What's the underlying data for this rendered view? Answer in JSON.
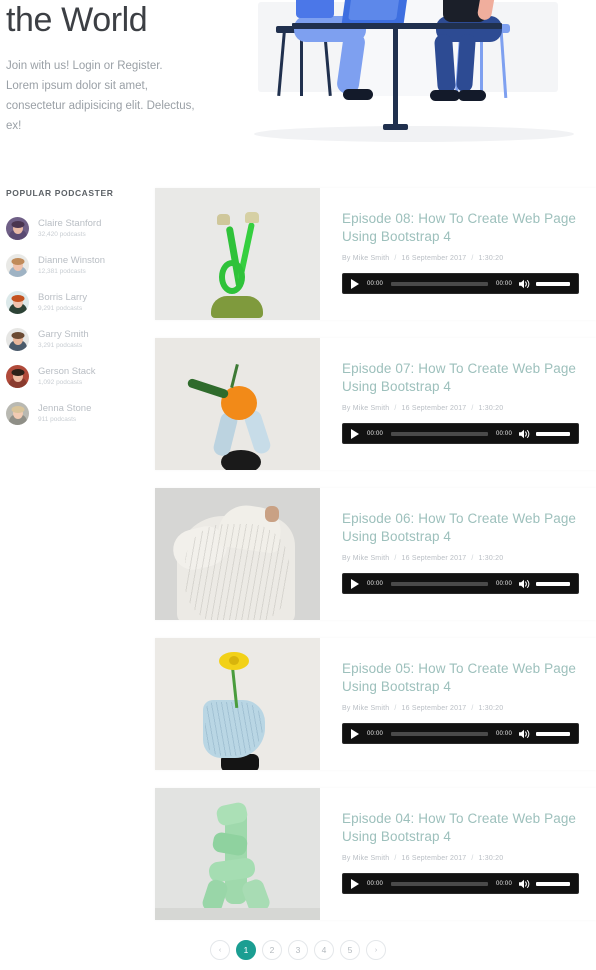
{
  "hero": {
    "title": "the World",
    "subtitle": "Join with us! Login or Register. Lorem ipsum dolor sit amet, consectetur adipisicing elit. Delectus, ex!",
    "illustration_name": "two-people-at-table-illustration"
  },
  "sidebar": {
    "title": "POPULAR PODCASTER",
    "podcasters": [
      {
        "name": "Claire Stanford",
        "count": "32,420 podcasts"
      },
      {
        "name": "Dianne Winston",
        "count": "12,381 podcasts"
      },
      {
        "name": "Borris Larry",
        "count": "9,291 podcasts"
      },
      {
        "name": "Garry Smith",
        "count": "3,291 podcasts"
      },
      {
        "name": "Gerson Stack",
        "count": "1,092 podcasts"
      },
      {
        "name": "Jenna Stone",
        "count": "911 podcasts"
      }
    ]
  },
  "episodes": [
    {
      "title": "Episode 08: How To Create Web Page Using Bootstrap 4",
      "author": "By Mike Smith",
      "date": "16 September 2017",
      "duration": "1:30:20",
      "thumb_name": "green-sprout-sculpture-thumbnail",
      "player": {
        "current_time": "00:00",
        "total_time": "00:00"
      }
    },
    {
      "title": "Episode 07: How To Create Web Page Using Bootstrap 4",
      "author": "By Mike Smith",
      "date": "16 September 2017",
      "duration": "1:30:20",
      "thumb_name": "orange-on-blue-sculpture-thumbnail",
      "player": {
        "current_time": "00:00",
        "total_time": "00:00"
      }
    },
    {
      "title": "Episode 06: How To Create Web Page Using Bootstrap 4",
      "author": "By Mike Smith",
      "date": "16 September 2017",
      "duration": "1:30:20",
      "thumb_name": "white-knit-sweater-thumbnail",
      "player": {
        "current_time": "00:00",
        "total_time": "00:00"
      }
    },
    {
      "title": "Episode 05: How To Create Web Page Using Bootstrap 4",
      "author": "By Mike Smith",
      "date": "16 September 2017",
      "duration": "1:30:20",
      "thumb_name": "yellow-flower-blue-vase-thumbnail",
      "player": {
        "current_time": "00:00",
        "total_time": "00:00"
      }
    },
    {
      "title": "Episode 04: How To Create Web Page Using Bootstrap 4",
      "author": "By Mike Smith",
      "date": "16 September 2017",
      "duration": "1:30:20",
      "thumb_name": "green-abstract-sculpture-thumbnail",
      "player": {
        "current_time": "00:00",
        "total_time": "00:00"
      }
    }
  ],
  "pagination": {
    "prev": "‹",
    "next": "›",
    "pages": [
      "1",
      "2",
      "3",
      "4",
      "5"
    ],
    "active": "1"
  },
  "colors": {
    "accent_teal": "#1b9e92",
    "episode_title": "#9dc0bc",
    "player_bg": "#111111",
    "muted_text": "#b9bec4"
  }
}
